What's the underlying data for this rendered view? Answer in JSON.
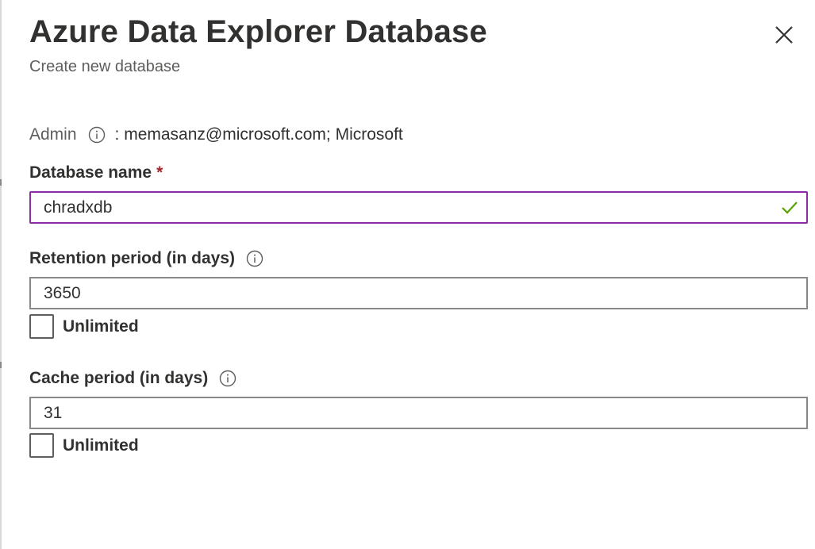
{
  "panel": {
    "title": "Azure Data Explorer Database",
    "subtitle": "Create new database",
    "close_icon": "close-icon"
  },
  "admin": {
    "label": "Admin",
    "info_icon": "info-icon",
    "value": ": memasanz@microsoft.com; Microsoft"
  },
  "database_name": {
    "label": "Database name",
    "required_marker": "*",
    "value": "chradxdb",
    "valid_icon": "checkmark-icon",
    "focus_color": "#8a2da5",
    "valid_color": "#57a300"
  },
  "retention": {
    "label": "Retention period (in days)",
    "info_icon": "info-icon",
    "value": "3650",
    "unlimited_label": "Unlimited",
    "unlimited_checked": false
  },
  "cache": {
    "label": "Cache period (in days)",
    "info_icon": "info-icon",
    "value": "31",
    "unlimited_label": "Unlimited",
    "unlimited_checked": false
  },
  "colors": {
    "required": "#a4262c",
    "text": "#323130",
    "secondary_text": "#605e5c",
    "border": "#8a8886"
  }
}
